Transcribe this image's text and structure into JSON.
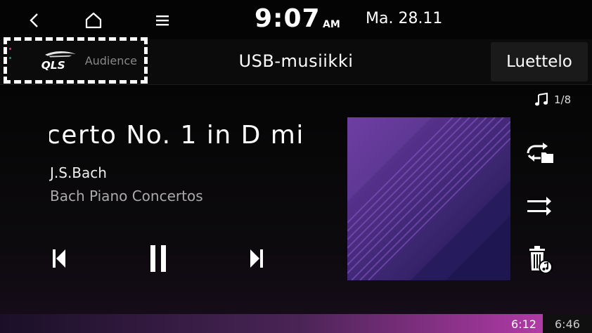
{
  "status_bar": {
    "time": "9:07",
    "ampm": "AM",
    "date": "Ma. 28.11"
  },
  "header": {
    "audio_brand": {
      "logo_text": "QLS",
      "label": "Audience"
    },
    "source_title": "USB-musiikki",
    "list_button_label": "Luettelo"
  },
  "track": {
    "counter": "1/8",
    "title": "certo No. 1 in D mi",
    "artist": "J.S.Bach",
    "album": "Bach Piano Concertos"
  },
  "progress": {
    "elapsed": "6:12",
    "total": "6:46",
    "fraction": 0.917
  },
  "icons": {
    "back": "back-arrow-icon",
    "home": "home-icon",
    "menu": "menu-icon",
    "music_note": "music-note-icon",
    "previous": "previous-track-icon",
    "pause": "pause-icon",
    "next": "next-track-icon",
    "repeat": "repeat-folder-icon",
    "shuffle": "shuffle-icon",
    "delete": "delete-track-icon"
  },
  "colors": {
    "accent": "#b13aa7",
    "brand_dot_top": "#d2358f",
    "brand_dot_bottom": "#2f8f6a",
    "highlight_border": "#d10000"
  }
}
